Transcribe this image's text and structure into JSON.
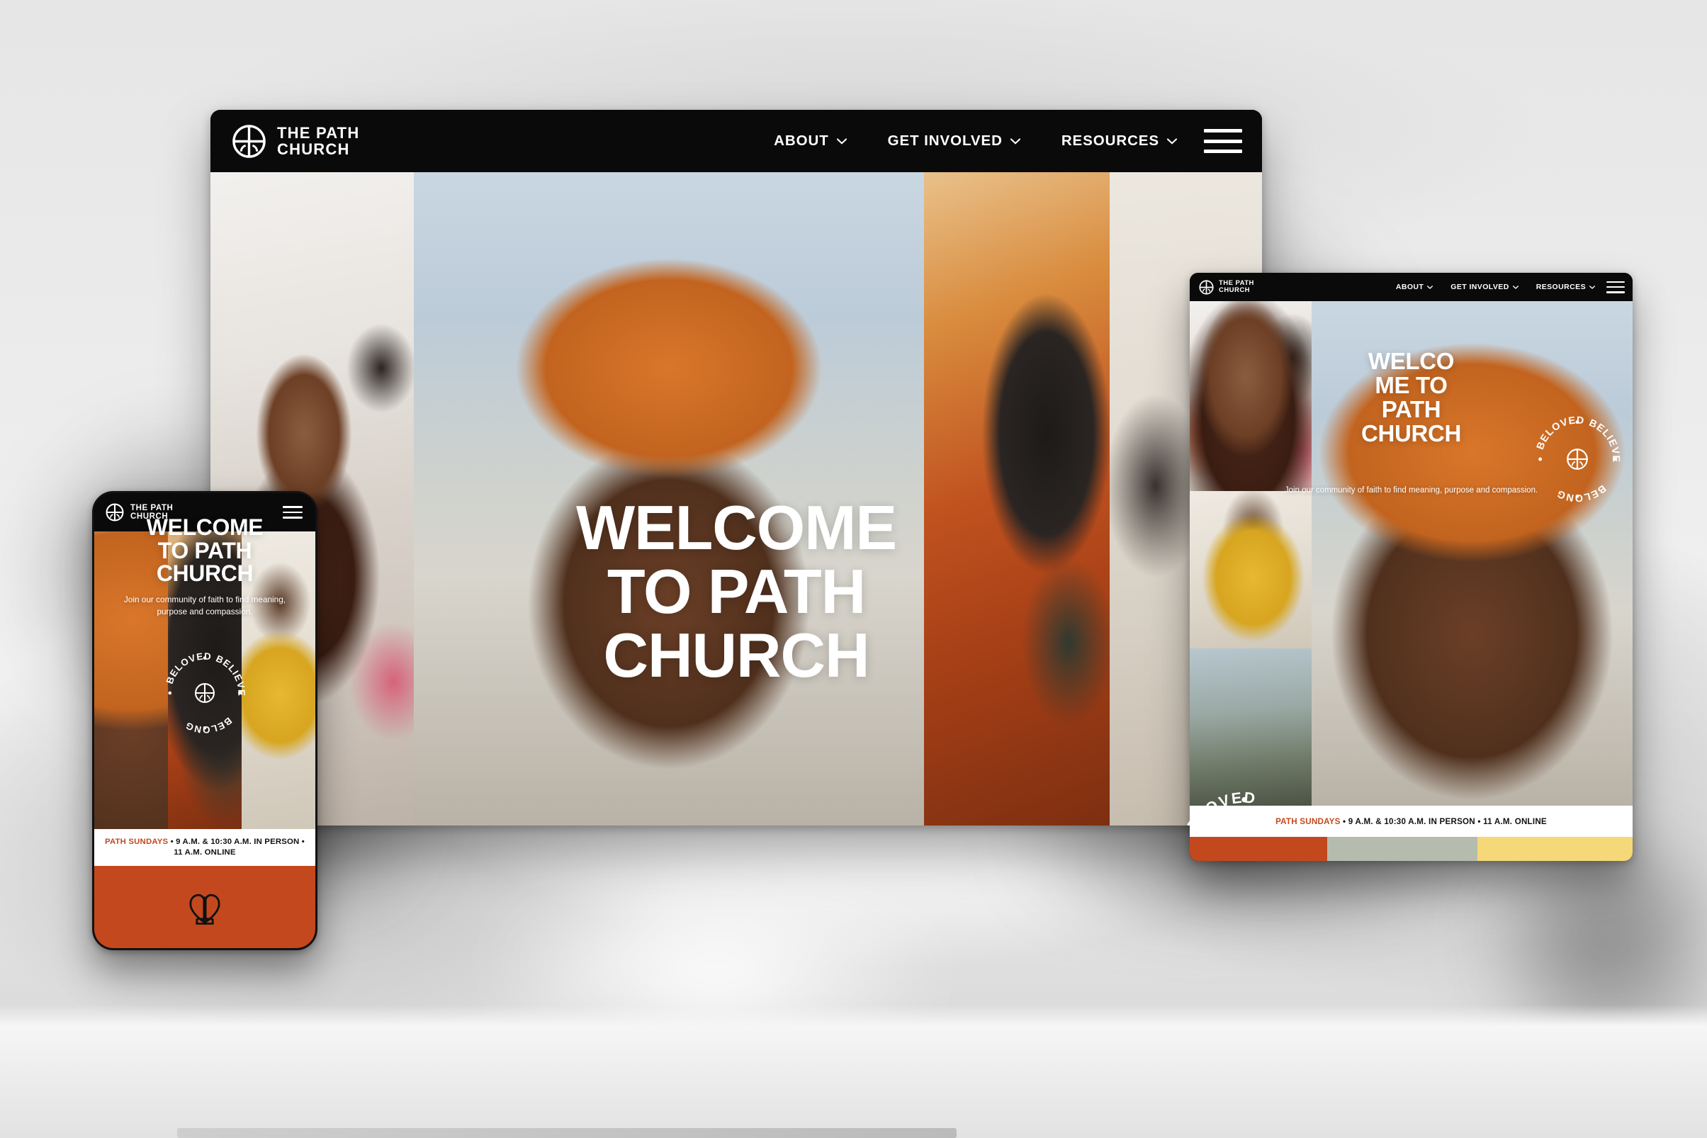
{
  "brand": {
    "name_line1": "THE PATH",
    "name_line2": "CHURCH",
    "logo_icon": "path-church-cross-circle-logo",
    "accent_orange": "#C4481E",
    "accent_sage": "#B5BCAD",
    "accent_yellow": "#F5D878",
    "nav_background": "#0A0A0A"
  },
  "nav": {
    "items": [
      {
        "label": "ABOUT",
        "has_dropdown": true,
        "dropdown_icon": "chevron-down-icon"
      },
      {
        "label": "GET INVOLVED",
        "has_dropdown": true,
        "dropdown_icon": "chevron-down-icon"
      },
      {
        "label": "RESOURCES",
        "has_dropdown": true,
        "dropdown_icon": "chevron-down-icon"
      }
    ],
    "menu_icon": "hamburger-menu-icon"
  },
  "desktop": {
    "headline_line1": "WELCOME",
    "headline_line2": "TO PATH",
    "headline_line3": "CHURCH"
  },
  "tablet": {
    "headline_line1": "WELCO",
    "headline_line2": "ME TO",
    "headline_line3": "PATH",
    "headline_line4": "CHURCH",
    "subtitle": "Join our community of faith to find meaning, purpose and compassion.",
    "service_accent": "PATH SUNDAYS",
    "service_rest": " • 9 A.M. & 10:30 A.M. IN PERSON • 11 A.M. ONLINE"
  },
  "phone": {
    "headline_line1": "WELCOME",
    "headline_line2": "TO PATH",
    "headline_line3": "CHURCH",
    "subtitle": "Join our community of faith to find meaning, purpose and compassion.",
    "service_accent": "PATH SUNDAYS",
    "service_rest": " • 9 A.M. & 10:30 A.M. IN PERSON • 11 A.M. ONLINE",
    "footer_icon": "two-hearts-icon"
  },
  "badge": {
    "word1": "BELOVED",
    "word2": "BELIEVE",
    "word3": "BELONG",
    "separator": "•",
    "center_icon": "path-church-cross-circle-logo"
  }
}
